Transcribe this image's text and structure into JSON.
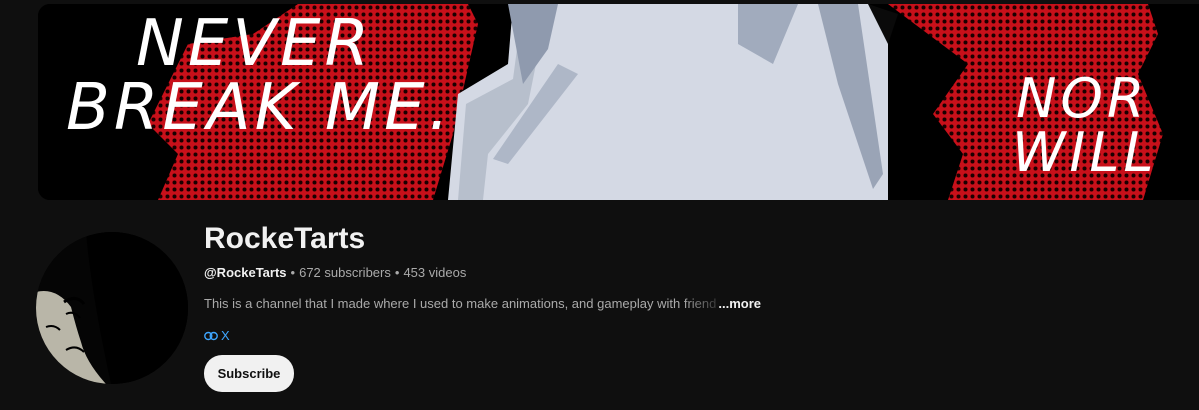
{
  "banner": {
    "left_lines": [
      "NEVER",
      "BREAK ME."
    ],
    "right_lines": [
      "NOR",
      "WILL"
    ]
  },
  "channel": {
    "name": "RockeTarts",
    "handle": "@RockeTarts",
    "subscribers": "672 subscribers",
    "videos": "453 videos",
    "description": "This is a channel that I made where I used to make animations, and gameplay with",
    "description_faded": "friend",
    "more_label": "...more",
    "link_label": "X",
    "link_icon": "link-icon",
    "subscribe_label": "Subscribe"
  },
  "colors": {
    "background": "#0f0f0f",
    "banner_red": "#c8101a",
    "link_blue": "#3ea6ff"
  }
}
